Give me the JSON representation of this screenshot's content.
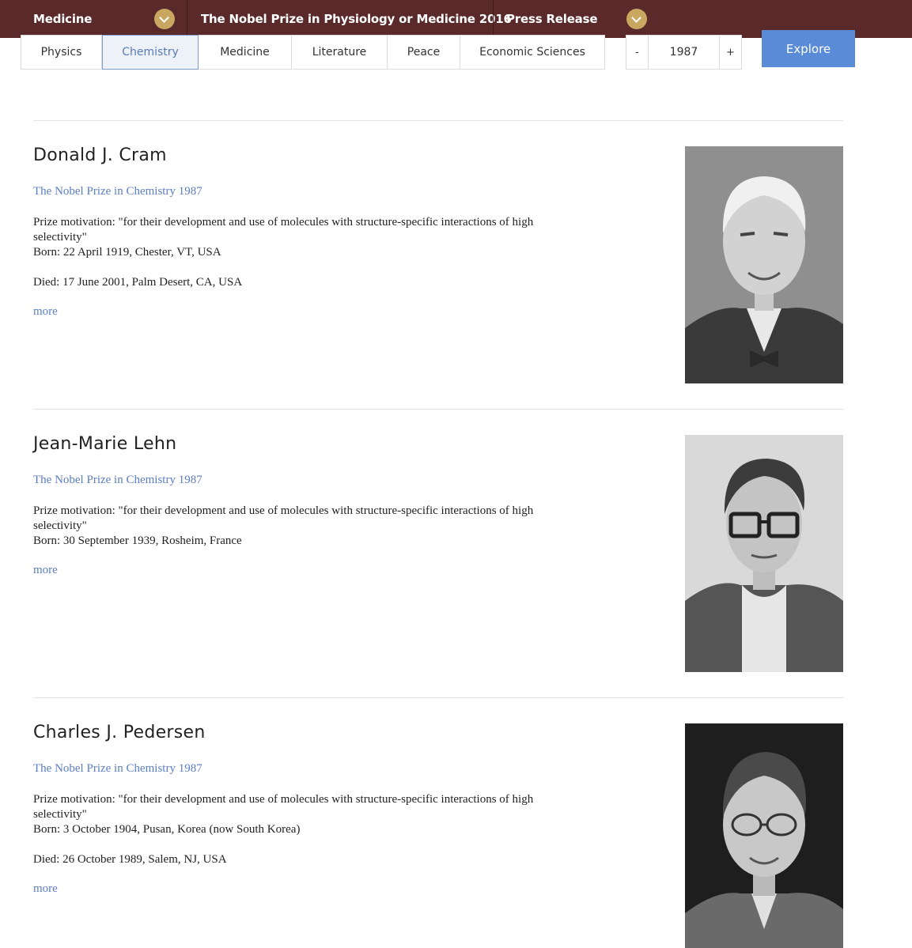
{
  "topbar": {
    "category": "Medicine",
    "article_title": "The Nobel Prize in Physiology or Medicine 2016",
    "press_release": "Press Release"
  },
  "tabs": [
    {
      "label": "Physics",
      "active": false
    },
    {
      "label": "Chemistry",
      "active": true
    },
    {
      "label": "Medicine",
      "active": false
    },
    {
      "label": "Literature",
      "active": false
    },
    {
      "label": "Peace",
      "active": false
    },
    {
      "label": "Economic Sciences",
      "active": false
    }
  ],
  "stepper": {
    "minus": "-",
    "year": "1987",
    "plus": "+"
  },
  "explore_label": "Explore",
  "laureates": [
    {
      "name": "Donald J. Cram",
      "prize": "The Nobel Prize in Chemistry 1987",
      "motivation": "Prize motivation: \"for their development and use of molecules with structure-specific interactions of high selectivity\"",
      "born": "Born: 22 April 1919, Chester, VT, USA",
      "died": "Died: 17 June 2001, Palm Desert, CA, USA",
      "more": "more"
    },
    {
      "name": "Jean-Marie Lehn",
      "prize": "The Nobel Prize in Chemistry 1987",
      "motivation": "Prize motivation: \"for their development and use of molecules with structure-specific interactions of high selectivity\"",
      "born": "Born: 30 September 1939, Rosheim, France",
      "more": "more"
    },
    {
      "name": "Charles J. Pedersen",
      "prize": "The Nobel Prize in Chemistry 1987",
      "motivation": "Prize motivation: \"for their development and use of molecules with structure-specific interactions of high selectivity\"",
      "born": "Born: 3 October 1904, Pusan, Korea (now South Korea)",
      "died": "Died: 26 October 1989, Salem, NJ, USA",
      "more": "more"
    }
  ],
  "colors": {
    "topbar_bg": "#5a2a2a",
    "chevron_gold": "#c9a760",
    "active_tab_text": "#5a7bb5",
    "explore_bg": "#5a8bd6",
    "link_blue": "#5b7ec0"
  }
}
